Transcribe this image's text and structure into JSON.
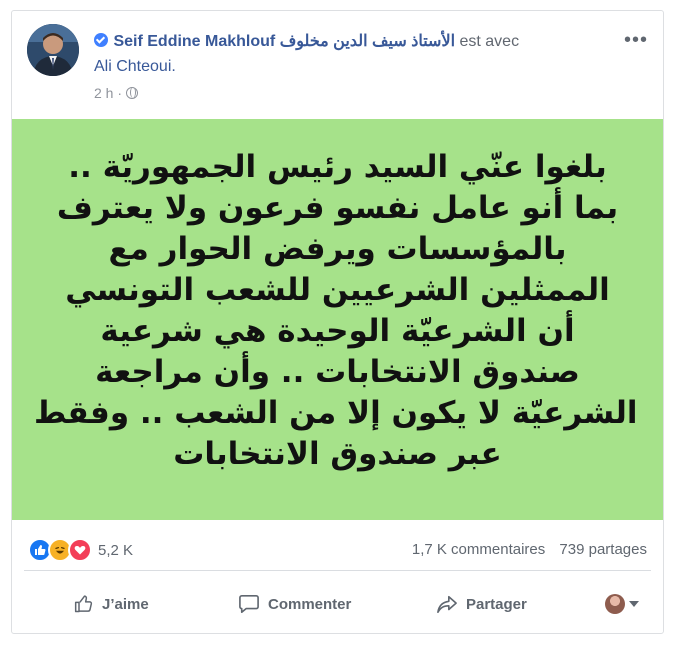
{
  "post": {
    "author_name": "Seif Eddine Makhlouf الأستاذ سيف الدين مخلوف",
    "with_text": "est avec",
    "tagged_user": "Ali Chteoui.",
    "time": "2 h ·",
    "image_text": [
      "بلغوا عنّي السيد رئيس الجمهوريّة ..",
      "بما أنو عامل نفسو فرعون ولا يعترف",
      "بالمؤسسات ويرفض الحوار مع",
      "الممثلين الشرعيين للشعب التونسي",
      "أن الشرعيّة الوحيدة هي شرعية",
      "صندوق الانتخابات .. وأن مراجعة",
      "الشرعيّة لا يكون إلا من الشعب .. وفقط",
      "عبر صندوق الانتخابات"
    ]
  },
  "stats": {
    "reactions_count": "5,2 K",
    "comments": "1,7 K commentaires",
    "shares": "739 partages"
  },
  "actions": {
    "like": "J’aime",
    "comment": "Commenter",
    "share": "Partager"
  },
  "icons": {
    "verified": "verified-badge-icon",
    "globe": "globe-icon",
    "more": "more-options-icon",
    "like": "thumbs-up-icon",
    "comment": "comment-bubble-icon",
    "share": "share-arrow-icon"
  },
  "colors": {
    "link": "#385898",
    "image_background": "#a6e28a",
    "secondary_text": "#606770"
  }
}
